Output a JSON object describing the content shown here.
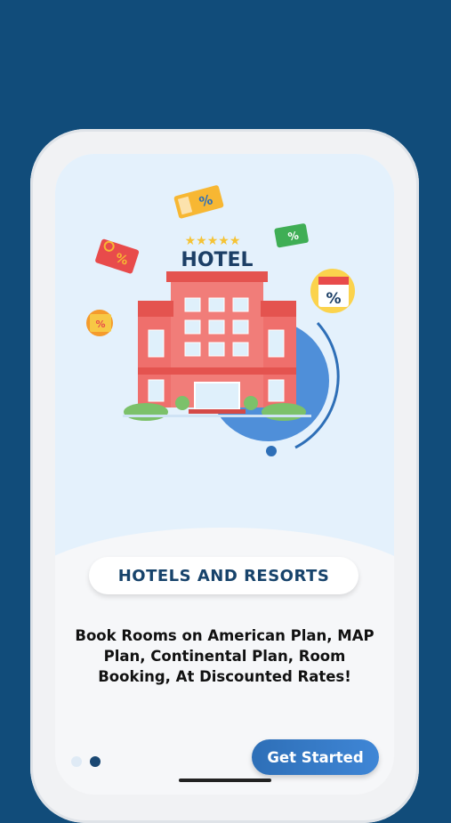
{
  "illustration": {
    "sign_text": "HOTEL",
    "stars": "★★★★★",
    "percent_symbol": "%"
  },
  "card_title": "HOTELS AND RESORTS",
  "description": "Book Rooms on American Plan, MAP Plan, Continental Plan, Room Booking, At Discounted Rates!",
  "pagination": {
    "total": 2,
    "active": 2
  },
  "cta_label": "Get Started",
  "colors": {
    "background": "#114c7a",
    "accent": "#2e6fb7",
    "title": "#17436b",
    "building": "#ef6f6c"
  }
}
